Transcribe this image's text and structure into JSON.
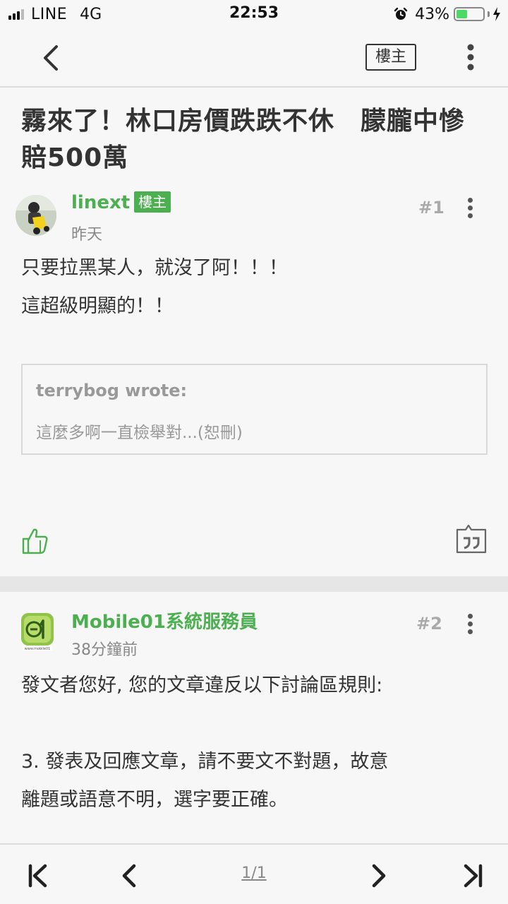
{
  "status_bar": {
    "carrier": "LINE",
    "network": "4G",
    "time": "22:53",
    "battery_percent": "43%",
    "battery_level": 0.43
  },
  "nav": {
    "back_icon": "chevron-left-icon",
    "owner_filter_label": "樓主",
    "more_icon": "vertical-dots-icon"
  },
  "thread": {
    "title": "霧來了！林口房價跌跌不休　朦朧中慘賠500萬"
  },
  "posts": [
    {
      "username": "linext",
      "badge": "樓主",
      "time": "昨天",
      "floor": "#1",
      "body_lines": [
        "只要拉黑某人，就沒了阿！！！",
        "這超級明顯的！！"
      ],
      "quote": {
        "author": "terrybog wrote:",
        "text": "這麼多啊一直檢舉對...(恕刪)"
      }
    },
    {
      "username": "Mobile01系統服務員",
      "time": "38分鐘前",
      "floor": "#2",
      "body_lines": [
        "發文者您好, 您的文章違反以下討論區規則:",
        "",
        "3. 發表及回應文章，請不要文不對題，故意",
        "離題或語意不明，選字要正確。"
      ]
    }
  ],
  "pager": {
    "page_label": "1/1",
    "icons": [
      "first-page-icon",
      "prev-page-icon",
      "next-page-icon",
      "last-page-icon"
    ]
  },
  "colors": {
    "accent_green": "#4caf50",
    "background": "#f7f7f7"
  }
}
